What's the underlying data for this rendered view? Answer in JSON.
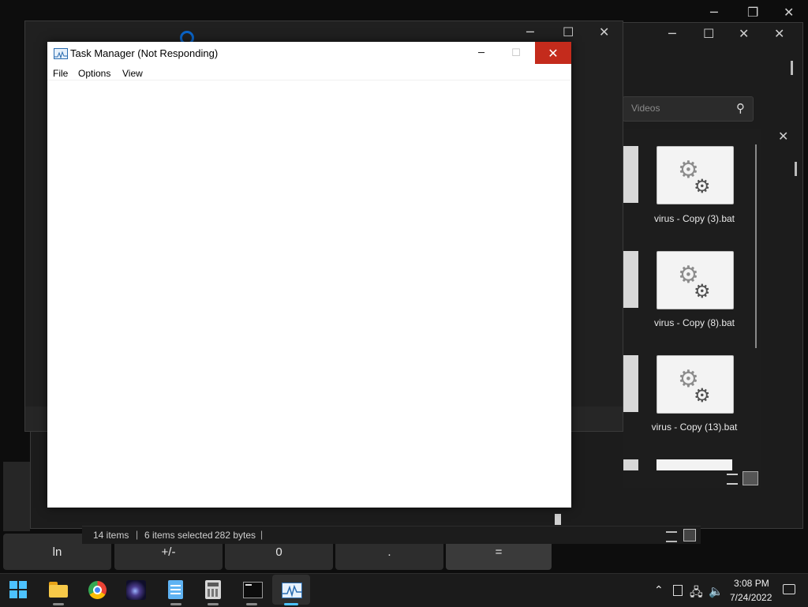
{
  "task_manager": {
    "title": "Task Manager (Not Responding)",
    "menu": [
      "File",
      "Options",
      "View"
    ],
    "minimize": "─",
    "maximize": "☐",
    "close": "✕"
  },
  "explorer": {
    "search_placeholder": "Videos",
    "status_items": "14 items",
    "status_selected": "6 items selected",
    "status_size": "282 bytes",
    "files": [
      {
        "name": "virus - Copy (3).bat"
      },
      {
        "name": "virus - Copy (8).bat"
      },
      {
        "name": "virus - Copy (13).bat"
      }
    ]
  },
  "calculator": {
    "keys": [
      "ln",
      "+/-",
      "0",
      ".",
      "="
    ]
  },
  "taskbar": {
    "apps": [
      "start-icon",
      "file-explorer-icon",
      "chrome-icon",
      "galaxy-app-icon",
      "notepad-icon",
      "calculator-icon",
      "terminal-icon",
      "task-manager-icon"
    ],
    "time": "3:08 PM",
    "date": "7/24/2022",
    "chevron": "^"
  },
  "colors": {
    "close_red": "#c42b1c",
    "taskbar": "#1b1b1b"
  }
}
